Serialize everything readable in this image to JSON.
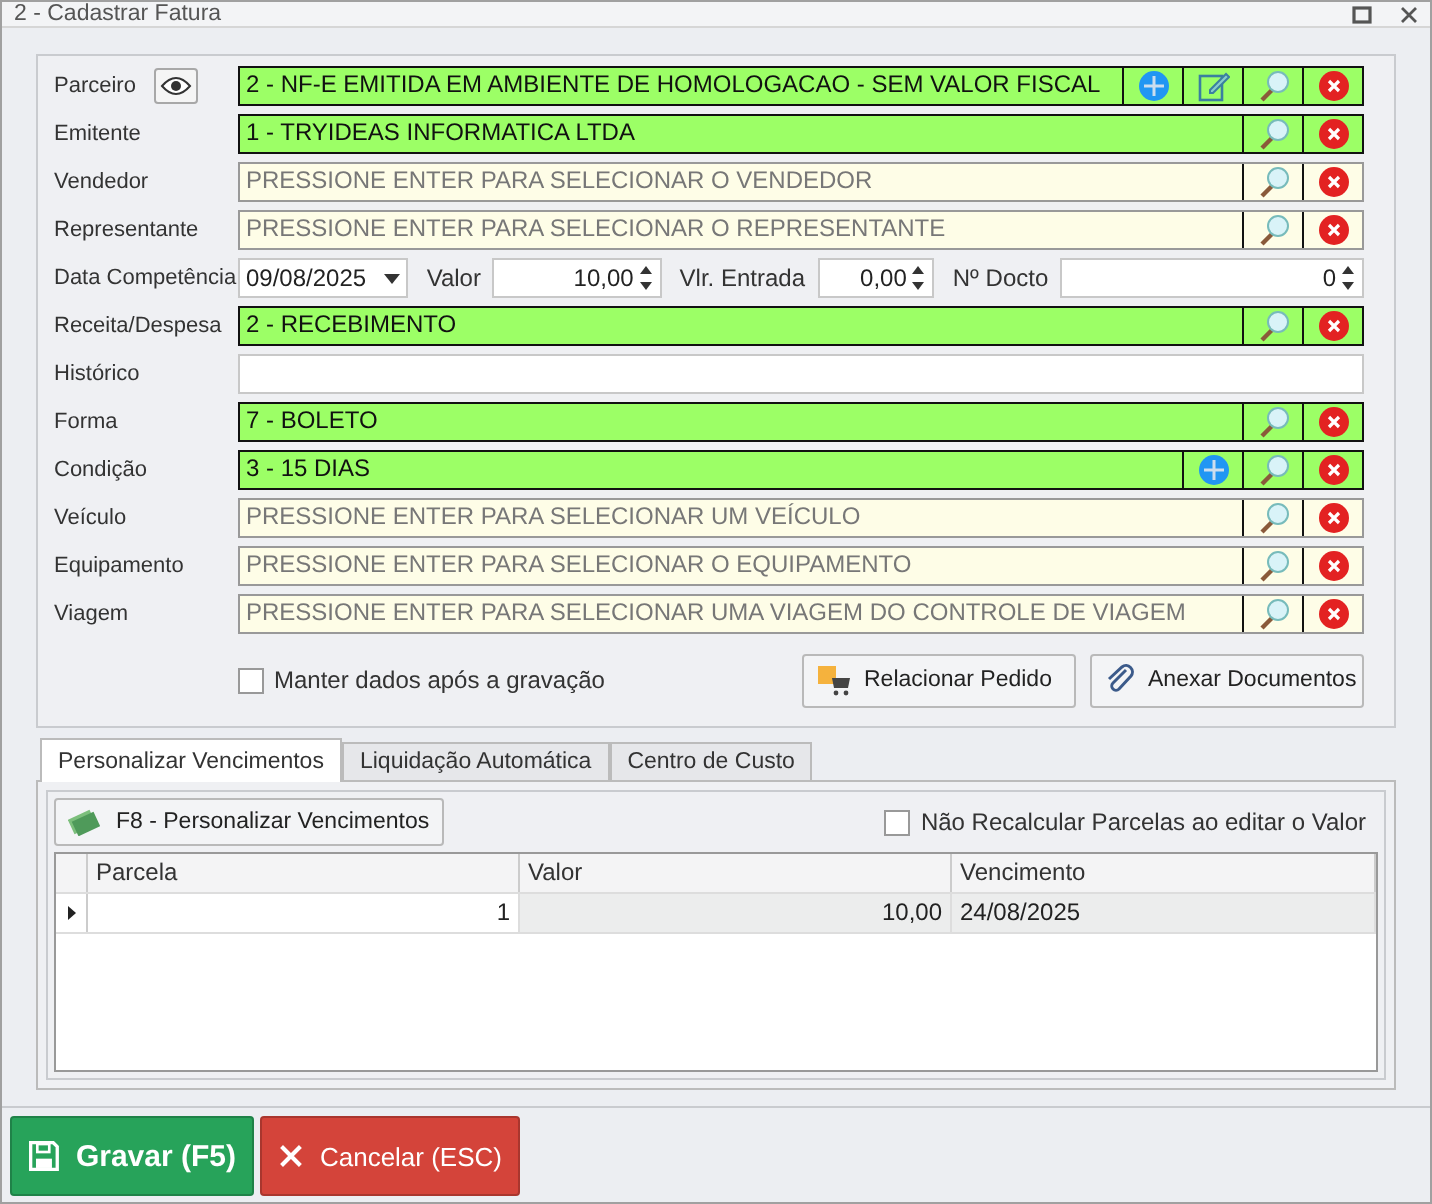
{
  "window": {
    "title": "2 - Cadastrar Fatura"
  },
  "fields": [
    {
      "kind": "lookup",
      "label": "Parceiro",
      "eye": true,
      "value": "2 - NF-E EMITIDA EM AMBIENTE DE HOMOLOGACAO - SEM VALOR FISCAL",
      "buttons": [
        {
          "kind": "add"
        },
        {
          "kind": "edit"
        },
        {
          "kind": "search"
        },
        {
          "kind": "clear"
        }
      ]
    },
    {
      "kind": "lookup",
      "label": "Emitente",
      "value": "1 - TRYIDEAS INFORMATICA LTDA",
      "buttons": [
        {
          "kind": "search"
        },
        {
          "kind": "clear"
        }
      ]
    },
    {
      "kind": "lookup",
      "label": "Vendedor",
      "placeholder": "PRESSIONE ENTER PARA SELECIONAR O VENDEDOR",
      "buttons": [
        {
          "kind": "search"
        },
        {
          "kind": "clear"
        }
      ]
    },
    {
      "kind": "lookup",
      "label": "Representante",
      "placeholder": "PRESSIONE ENTER PARA SELECIONAR O REPRESENTANTE",
      "buttons": [
        {
          "kind": "search"
        },
        {
          "kind": "clear"
        }
      ]
    },
    {
      "kind": "numbers",
      "label": "Data Competência",
      "date": "09/08/2025",
      "items": [
        {
          "label": "Valor",
          "value": "10,00"
        },
        {
          "label": "Vlr. Entrada",
          "value": "0,00"
        },
        {
          "label": "Nº Docto",
          "value": "0"
        }
      ]
    },
    {
      "kind": "lookup",
      "label": "Receita/Despesa",
      "value": "2 - RECEBIMENTO",
      "buttons": [
        {
          "kind": "search"
        },
        {
          "kind": "clear"
        }
      ]
    },
    {
      "kind": "text",
      "label": "Histórico"
    },
    {
      "kind": "lookup",
      "label": "Forma",
      "value": "7 - BOLETO",
      "buttons": [
        {
          "kind": "search"
        },
        {
          "kind": "clear"
        }
      ]
    },
    {
      "kind": "lookup",
      "label": "Condição",
      "value": "3 - 15 DIAS",
      "buttons": [
        {
          "kind": "add"
        },
        {
          "kind": "search"
        },
        {
          "kind": "clear"
        }
      ]
    },
    {
      "kind": "lookup",
      "label": "Veículo",
      "placeholder": "PRESSIONE ENTER PARA SELECIONAR UM VEÍCULO",
      "buttons": [
        {
          "kind": "search"
        },
        {
          "kind": "clear"
        }
      ]
    },
    {
      "kind": "lookup",
      "label": "Equipamento",
      "placeholder": "PRESSIONE ENTER PARA SELECIONAR O EQUIPAMENTO",
      "buttons": [
        {
          "kind": "search"
        },
        {
          "kind": "clear"
        }
      ]
    },
    {
      "kind": "lookup",
      "label": "Viagem",
      "placeholder": "PRESSIONE ENTER PARA SELECIONAR UMA VIAGEM DO CONTROLE DE VIAGEM",
      "buttons": [
        {
          "kind": "search"
        },
        {
          "kind": "clear"
        }
      ]
    }
  ],
  "keep_data": {
    "label": "Manter dados após a gravação",
    "checked": false
  },
  "actions": [
    "Relacionar Pedido",
    "Anexar Documentos"
  ],
  "tabs": [
    {
      "label": "Personalizar Vencimentos",
      "selected": true
    },
    {
      "label": "Liquidação Automática",
      "selected": false
    },
    {
      "label": "Centro de Custo",
      "selected": false
    }
  ],
  "customize_button": "F8 - Personalizar Vencimentos",
  "no_recalc": {
    "label": "Não Recalcular Parcelas ao editar o Valor",
    "checked": false
  },
  "table": {
    "columns": [
      "Parcela",
      "Valor",
      "Vencimento"
    ],
    "rows": [
      {
        "selected": true,
        "cells": [
          "1",
          "10,00",
          "24/08/2025"
        ]
      }
    ]
  },
  "save_button": "Gravar (F5)",
  "cancel_button": "Cancelar (ESC)"
}
